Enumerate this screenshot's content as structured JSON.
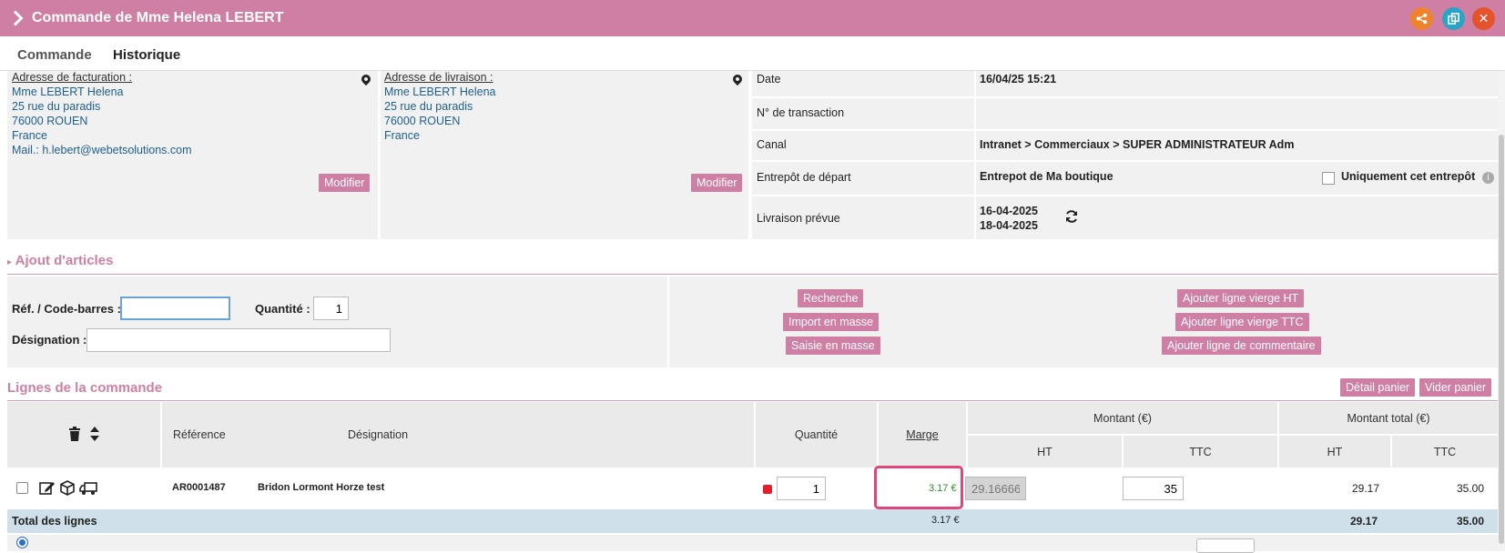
{
  "window": {
    "title": "Commande de Mme Helena LEBERT",
    "share_icon": "share-icon",
    "duplicate_icon": "copy-icon",
    "close_icon": "close-icon",
    "colors": {
      "brand": "#cf7fa3",
      "orange": "#f0822b",
      "blue": "#2aa3c8",
      "red": "#e5532d"
    }
  },
  "tabs": [
    {
      "label": "Commande"
    },
    {
      "label": "Historique"
    }
  ],
  "billing": {
    "label": "Adresse de facturation :",
    "lines": [
      "Mme LEBERT Helena",
      "25 rue du paradis",
      "76000 ROUEN",
      "France",
      "Mail.: h.lebert@webetsolutions.com"
    ],
    "edit_label": "Modifier"
  },
  "delivery": {
    "label": "Adresse de livraison :",
    "lines": [
      "Mme LEBERT Helena",
      "25 rue du paradis",
      "76000 ROUEN",
      "France"
    ],
    "edit_label": "Modifier"
  },
  "info": {
    "date_label": "Date",
    "date_value": "16/04/25 15:21",
    "transaction_label": "N° de transaction",
    "transaction_value": "",
    "canal_label": "Canal",
    "canal_value": "Intranet > Commerciaux > SUPER ADMINISTRATEUR Adm",
    "warehouse_label": "Entrepôt de départ",
    "warehouse_value": "Entrepot de Ma boutique",
    "only_warehouse_label": "Uniquement cet entrepôt",
    "delivery_label": "Livraison prévue",
    "delivery_from": "16-04-2025",
    "delivery_to": "18-04-2025"
  },
  "ajout": {
    "title": "Ajout d'articles",
    "ref_label": "Réf. / Code-barres :",
    "ref_value": "",
    "qty_label": "Quantité :",
    "qty_value": "1",
    "designation_label": "Désignation :",
    "designation_value": "",
    "buttons_left": [
      "Recherche",
      "Import en masse",
      "Saisie en masse"
    ],
    "buttons_right": [
      "Ajouter ligne vierge HT",
      "Ajouter ligne vierge TTC",
      "Ajouter ligne de commentaire"
    ]
  },
  "lines": {
    "title": "Lignes de la commande",
    "detail_label": "Détail panier",
    "empty_label": "Vider panier",
    "headers": {
      "reference": "Référence",
      "designation": "Désignation",
      "quantite": "Quantité",
      "marge": "Marge",
      "montant": "Montant (€)",
      "montant_total": "Montant total (€)",
      "ht": "HT",
      "ttc": "TTC"
    },
    "rows": [
      {
        "reference": "AR0001487",
        "designation": "Bridon Lormont Horze test",
        "quantite": "1",
        "marge": "3.17 €",
        "ht": "29.16666",
        "ttc": "35",
        "total_ht": "29.17",
        "total_ttc": "35.00"
      }
    ],
    "total": {
      "label": "Total des lignes",
      "marge": "3.17 €",
      "ht": "29.17",
      "ttc": "35.00"
    }
  }
}
